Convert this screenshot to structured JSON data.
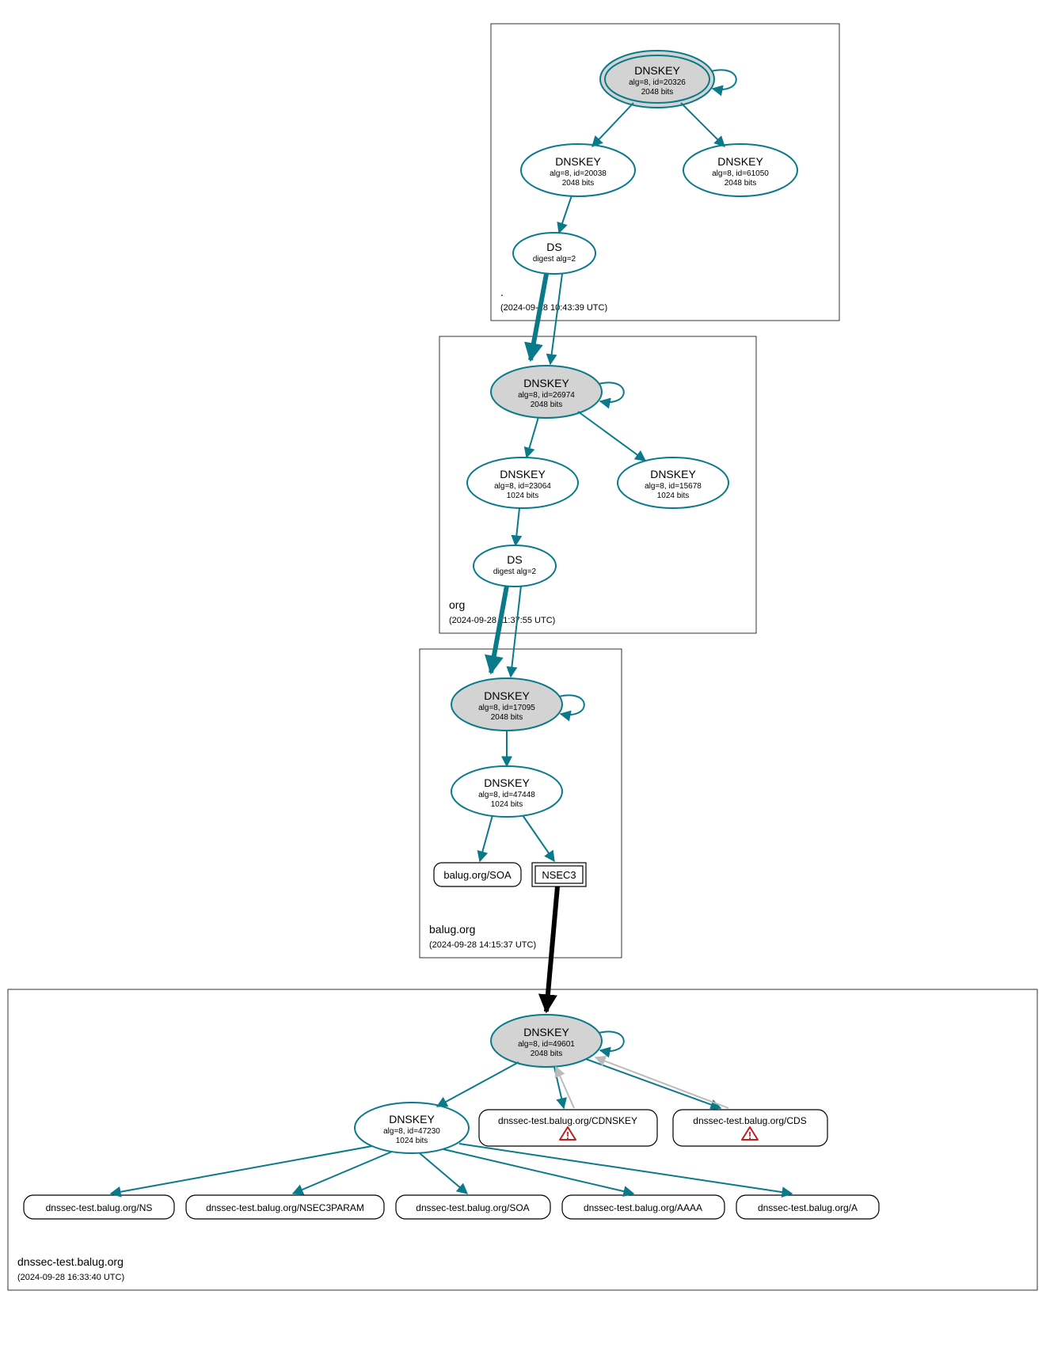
{
  "zones": {
    "root": {
      "name": ".",
      "time": "(2024-09-28 10:43:39 UTC)"
    },
    "org": {
      "name": "org",
      "time": "(2024-09-28 11:37:55 UTC)"
    },
    "balug": {
      "name": "balug.org",
      "time": "(2024-09-28 14:15:37 UTC)"
    },
    "dnssec": {
      "name": "dnssec-test.balug.org",
      "time": "(2024-09-28 16:33:40 UTC)"
    }
  },
  "nodes": {
    "root_ksk": {
      "title": "DNSKEY",
      "sub1": "alg=8, id=20326",
      "sub2": "2048 bits"
    },
    "root_zsk1": {
      "title": "DNSKEY",
      "sub1": "alg=8, id=20038",
      "sub2": "2048 bits"
    },
    "root_zsk2": {
      "title": "DNSKEY",
      "sub1": "alg=8, id=61050",
      "sub2": "2048 bits"
    },
    "root_ds": {
      "title": "DS",
      "sub1": "digest alg=2"
    },
    "org_ksk": {
      "title": "DNSKEY",
      "sub1": "alg=8, id=26974",
      "sub2": "2048 bits"
    },
    "org_zsk1": {
      "title": "DNSKEY",
      "sub1": "alg=8, id=23064",
      "sub2": "1024 bits"
    },
    "org_zsk2": {
      "title": "DNSKEY",
      "sub1": "alg=8, id=15678",
      "sub2": "1024 bits"
    },
    "org_ds": {
      "title": "DS",
      "sub1": "digest alg=2"
    },
    "balug_ksk": {
      "title": "DNSKEY",
      "sub1": "alg=8, id=17095",
      "sub2": "2048 bits"
    },
    "balug_zsk": {
      "title": "DNSKEY",
      "sub1": "alg=8, id=47448",
      "sub2": "1024 bits"
    },
    "balug_soa": {
      "label": "balug.org/SOA"
    },
    "balug_nsec3": {
      "label": "NSEC3"
    },
    "dt_ksk": {
      "title": "DNSKEY",
      "sub1": "alg=8, id=49601",
      "sub2": "2048 bits"
    },
    "dt_zsk": {
      "title": "DNSKEY",
      "sub1": "alg=8, id=47230",
      "sub2": "1024 bits"
    },
    "dt_cdnskey": {
      "label": "dnssec-test.balug.org/CDNSKEY"
    },
    "dt_cds": {
      "label": "dnssec-test.balug.org/CDS"
    },
    "dt_ns": {
      "label": "dnssec-test.balug.org/NS"
    },
    "dt_n3p": {
      "label": "dnssec-test.balug.org/NSEC3PARAM"
    },
    "dt_soa": {
      "label": "dnssec-test.balug.org/SOA"
    },
    "dt_aaaa": {
      "label": "dnssec-test.balug.org/AAAA"
    },
    "dt_a": {
      "label": "dnssec-test.balug.org/A"
    }
  }
}
